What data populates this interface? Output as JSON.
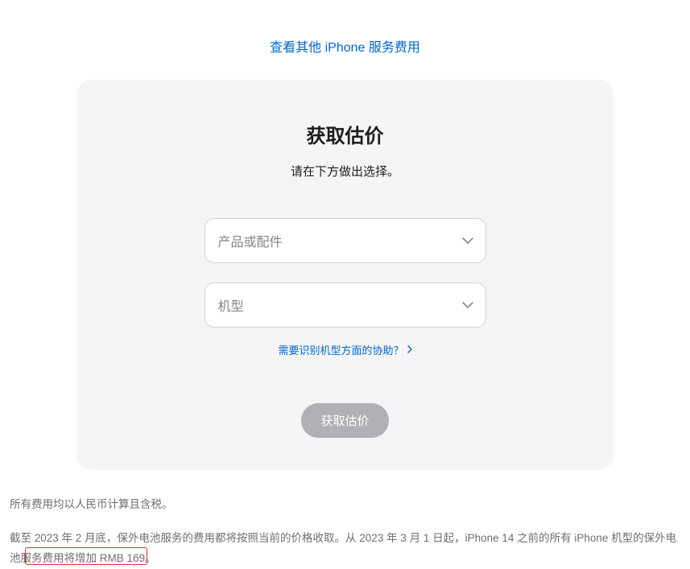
{
  "topLink": {
    "label": "查看其他 iPhone 服务费用"
  },
  "card": {
    "title": "获取估价",
    "subtitle": "请在下方做出选择。",
    "select1": {
      "placeholder": "产品或配件"
    },
    "select2": {
      "placeholder": "机型"
    },
    "helpLink": {
      "label": "需要识别机型方面的协助？"
    },
    "submit": {
      "label": "获取估价"
    }
  },
  "footnotes": {
    "line1": "所有费用均以人民币计算且含税。",
    "line2": "截至 2023 年 2 月底，保外电池服务的费用都将按照当前的价格收取。从 2023 年 3 月 1 日起，iPhone 14 之前的所有 iPhone 机型的保外电池服务费用将增加 RMB 169。"
  }
}
